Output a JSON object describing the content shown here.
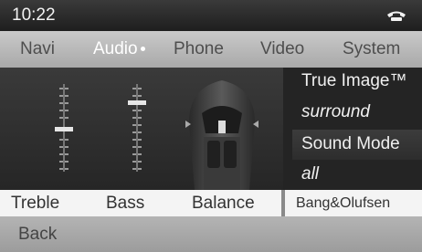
{
  "status": {
    "time": "10:22",
    "phone_icon": "phone-handset-icon"
  },
  "menu": [
    {
      "label": "Navi"
    },
    {
      "label": "Audio"
    },
    {
      "label": "Phone"
    },
    {
      "label": "Video"
    },
    {
      "label": "System"
    }
  ],
  "menu_active_index": 1,
  "sound_panel": {
    "line1": "True Image™",
    "line2": "surround",
    "line3": "Sound Mode",
    "line4": "all"
  },
  "bottom": {
    "treble": "Treble",
    "bass": "Bass",
    "balance": "Balance",
    "brand": "Bang&Olufsen"
  },
  "back": "Back",
  "colors": {
    "active_menu": "#ffffff",
    "menu_text": "#4e4e4e"
  }
}
